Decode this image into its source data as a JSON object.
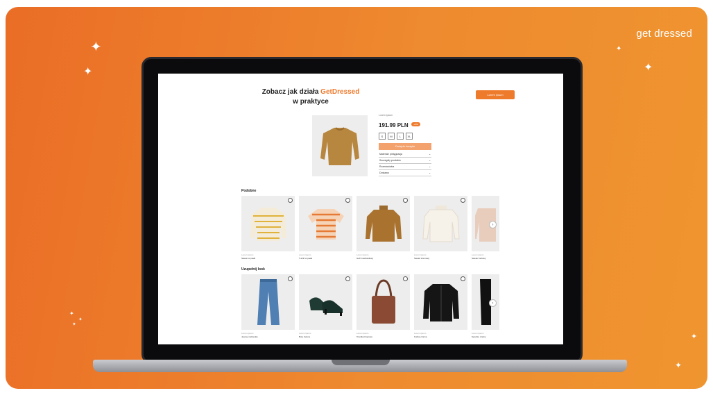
{
  "brand": {
    "name": "get dressed"
  },
  "page": {
    "title_part1": "Zobacz jak działa ",
    "title_accent": "GetDressed",
    "title_part2": "w praktyce",
    "cta_label": "Lorem ipsum"
  },
  "product": {
    "subtitle": "Lorem ipsum",
    "price": "191.99 PLN",
    "badge": "-20%",
    "sizes": [
      "S",
      "M",
      "L",
      "XL"
    ],
    "buy_label": "Dodaj do koszyka",
    "accordion": [
      "Materiał i pielęgnacja",
      "Szczegóły produktu",
      "Rozmiarówka",
      "Dostawa"
    ]
  },
  "sections": [
    {
      "label": "Podobne",
      "items": [
        {
          "meta": "Lorem ipsum",
          "name": "Sweter w paski"
        },
        {
          "meta": "Lorem ipsum",
          "name": "T-shirt w paski"
        },
        {
          "meta": "Lorem ipsum",
          "name": "Golf musztardowy"
        },
        {
          "meta": "Lorem ipsum",
          "name": "Sweter kremowy"
        },
        {
          "meta": "Lorem ipsum",
          "name": "Sweter beżowy"
        }
      ]
    },
    {
      "label": "Uzupełnij look",
      "items": [
        {
          "meta": "Lorem ipsum",
          "name": "Jeansy niebieskie"
        },
        {
          "meta": "Lorem ipsum",
          "name": "Buty zielone"
        },
        {
          "meta": "Lorem ipsum",
          "name": "Torebka brązowa"
        },
        {
          "meta": "Lorem ipsum",
          "name": "Kurtka czarna"
        },
        {
          "meta": "Lorem ipsum",
          "name": "Spodnie czarne"
        }
      ]
    }
  ],
  "colors": {
    "accent": "#ee7a2c",
    "background": "#ef8a2f"
  }
}
